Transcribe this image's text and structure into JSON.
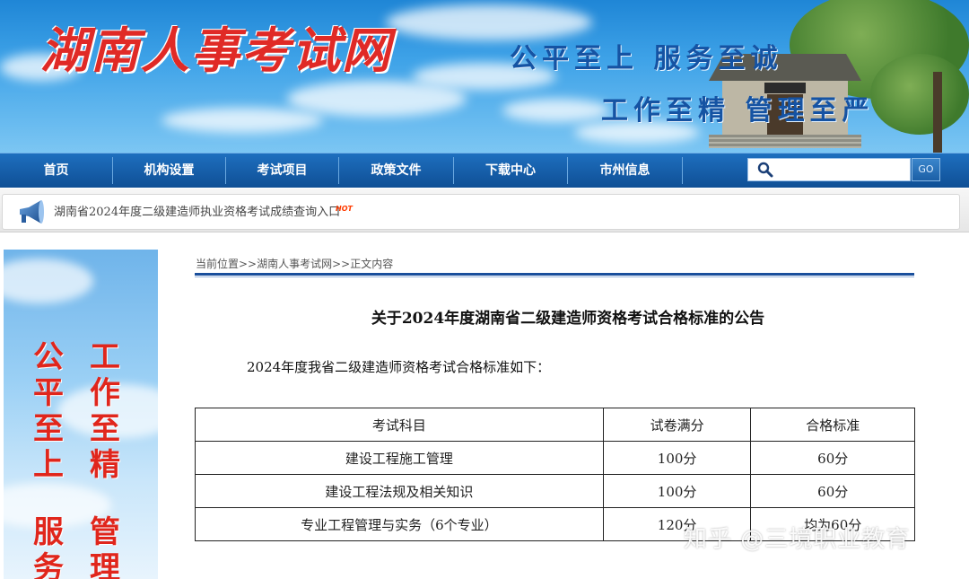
{
  "header": {
    "logo_text": "湖南人事考试网",
    "slogan_top": "公平至上  服务至诚",
    "slogan_bottom": "工作至精  管理至严",
    "colors": {
      "logo": "#e02a26",
      "slogan": "#1553a3",
      "sky": "#3fa3e8"
    }
  },
  "nav": {
    "items": [
      "首页",
      "机构设置",
      "考试项目",
      "政策文件",
      "下载中心",
      "市州信息"
    ],
    "search_placeholder": "",
    "go_label": "GO",
    "search_icon": "search-icon"
  },
  "notice": {
    "text": "湖南省2024年度二级建造师执业资格考试成绩查询入口",
    "hot_badge": "HOT",
    "icon": "megaphone-icon"
  },
  "side_banner": {
    "col1": [
      "公",
      "平",
      "至",
      "上",
      "",
      "服",
      "务"
    ],
    "col2": [
      "工",
      "作",
      "至",
      "精",
      "",
      "管",
      "理"
    ]
  },
  "content": {
    "breadcrumb": "当前位置>>湖南人事考试网>>正文内容",
    "title": "关于2024年度湖南省二级建造师资格考试合格标准的公告",
    "intro": "2024年度我省二级建造师资格考试合格标准如下：",
    "table": {
      "headers": [
        "考试科目",
        "试卷满分",
        "合格标准"
      ],
      "rows": [
        [
          "建设工程施工管理",
          "100分",
          "60分"
        ],
        [
          "建设工程法规及相关知识",
          "100分",
          "60分"
        ],
        [
          "专业工程管理与实务（6个专业）",
          "120分",
          "均为60分"
        ]
      ]
    }
  },
  "watermark": "知乎 @三境职业教育"
}
